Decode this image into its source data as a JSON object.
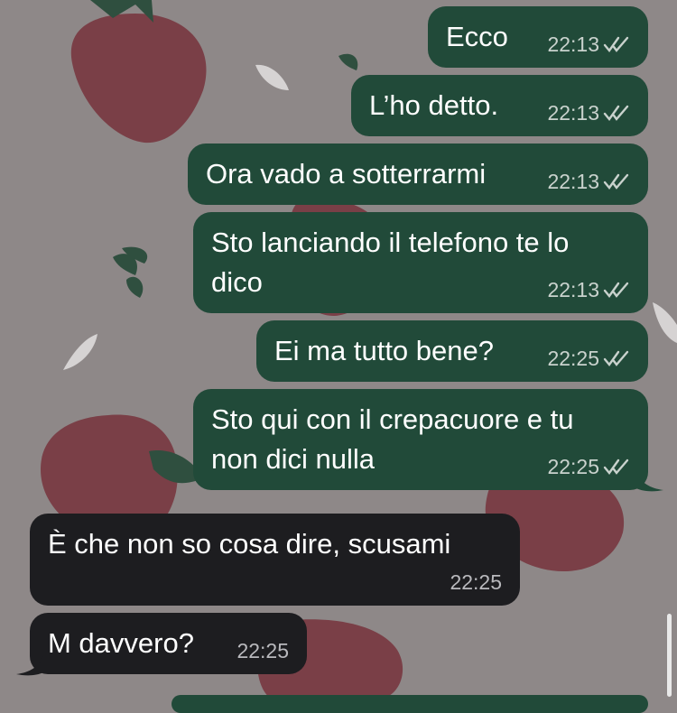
{
  "chat": {
    "messages": [
      {
        "text": "Ecco",
        "time": "22:13",
        "status": "read"
      },
      {
        "text": "L’ho detto.",
        "time": "22:13",
        "status": "read"
      },
      {
        "text": "Ora vado a sotterrarmi",
        "time": "22:13",
        "status": "read"
      },
      {
        "text": "Sto lanciando il telefono te lo dico",
        "time": "22:13",
        "status": "read"
      },
      {
        "text": "Ei ma tutto bene?",
        "time": "22:25",
        "status": "read"
      },
      {
        "text": "Sto qui con il crepacuore e tu non dici nulla",
        "time": "22:25",
        "status": "read"
      },
      {
        "text": "È che non so cosa dire, scusami",
        "time": "22:25"
      },
      {
        "text": "M davvero?",
        "time": "22:25"
      }
    ]
  },
  "theme": {
    "outgoing_bubble": "#214a39",
    "incoming_bubble": "#1d1d20",
    "wallpaper": "#8e8888",
    "strawberry": "#7a3f47",
    "leaf": "#2f4f3f"
  },
  "icons": {
    "read_receipt": "double-check-icon",
    "wallpaper_pattern": "strawberry-pattern"
  }
}
